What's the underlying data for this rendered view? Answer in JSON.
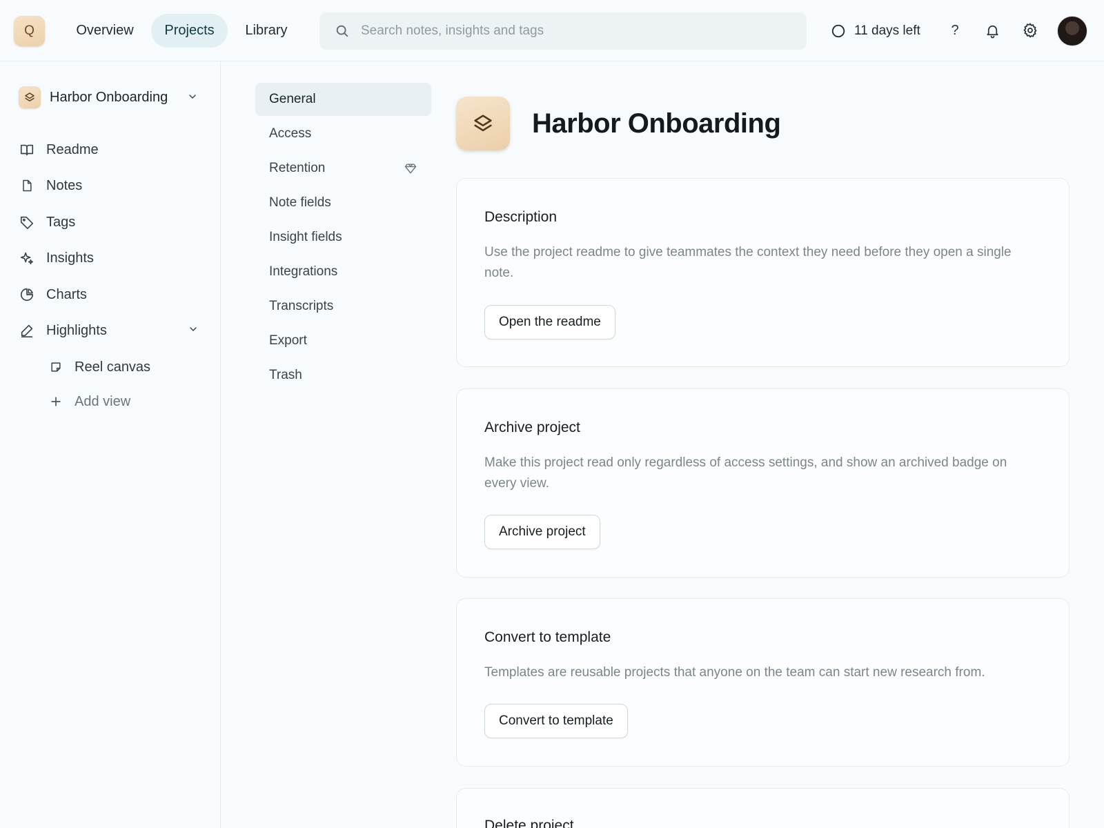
{
  "app": {
    "logo_letter": "Q",
    "nav": [
      {
        "label": "Overview"
      },
      {
        "label": "Projects"
      },
      {
        "label": "Library"
      }
    ],
    "search_placeholder": "Search notes, insights and tags",
    "trial_label": "11 days left",
    "help_label": "?"
  },
  "sidebar": {
    "project_name": "Harbor Onboarding",
    "items": [
      {
        "label": "Readme",
        "icon": "book-icon"
      },
      {
        "label": "Notes",
        "icon": "document-icon"
      },
      {
        "label": "Tags",
        "icon": "tag-icon"
      },
      {
        "label": "Insights",
        "icon": "sparkle-icon"
      },
      {
        "label": "Charts",
        "icon": "pie-chart-icon"
      },
      {
        "label": "Highlights",
        "icon": "pen-icon"
      }
    ],
    "sub_items": [
      {
        "label": "Reel canvas",
        "icon": "sticky-note-icon"
      },
      {
        "label": "Add view",
        "icon": "plus-icon"
      }
    ]
  },
  "settings_nav": [
    {
      "label": "General"
    },
    {
      "label": "Access"
    },
    {
      "label": "Retention"
    },
    {
      "label": "Note fields"
    },
    {
      "label": "Insight fields"
    },
    {
      "label": "Integrations"
    },
    {
      "label": "Transcripts"
    },
    {
      "label": "Export"
    },
    {
      "label": "Trash"
    }
  ],
  "main": {
    "title": "Harbor Onboarding",
    "cards": [
      {
        "title": "Description",
        "text": "Use the project readme to give teammates the context they need before they open a single note.",
        "button": "Open the readme"
      },
      {
        "title": "Archive project",
        "text": "Make this project read only regardless of access settings, and show an archived badge on every view.",
        "button": "Archive project"
      },
      {
        "title": "Convert to template",
        "text": "Templates are reusable projects that anyone on the team can start new research from.",
        "button": "Convert to template"
      },
      {
        "title": "Delete project"
      }
    ]
  },
  "colors": {
    "accent_bg": "#e2f0f3",
    "brand_tan": "#ecd0ab",
    "page_bg": "#f7fbfd"
  }
}
